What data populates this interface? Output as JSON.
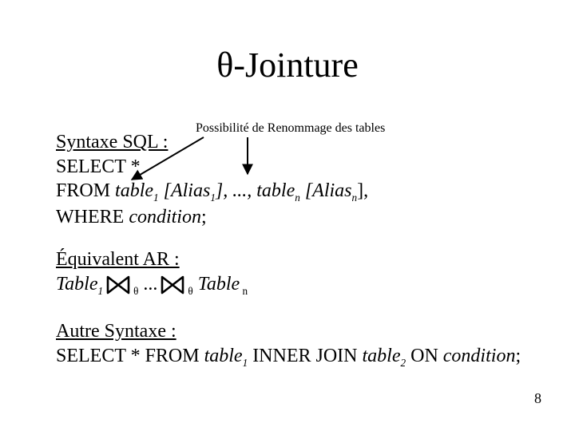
{
  "title": {
    "theta": "θ",
    "suffix": "-Jointure"
  },
  "annotation": "Possibilité de Renommage des tables",
  "sql": {
    "heading": "Syntaxe SQL :",
    "select": "SELECT *",
    "from_prefix": "FROM ",
    "from_t1": "table",
    "from_t1_sub": "1",
    "from_a1": " [Alias",
    "from_a1_sub": "1",
    "from_mid": "], ..., ",
    "from_tn": "table",
    "from_tn_sub": "n",
    "from_an": " [Alias",
    "from_an_sub": "n",
    "from_end": "],",
    "where_prefix": "WHERE ",
    "where_cond": "condition",
    "where_end": ";"
  },
  "ar": {
    "heading": "Équivalent AR :",
    "t1": "Table",
    "t1_sub": "1",
    "theta1": "θ",
    "dots": " ...",
    "theta2": "θ",
    "tn": " Table",
    "tn_sub": " n"
  },
  "alt": {
    "heading": "Autre Syntaxe :",
    "line_prefix": "SELECT * FROM ",
    "t1": "table",
    "t1_sub": "1",
    "inner": " INNER JOIN ",
    "t2": "table",
    "t2_sub": "2",
    "on": " ON ",
    "cond": "condition",
    "end": ";"
  },
  "page_number": "8"
}
